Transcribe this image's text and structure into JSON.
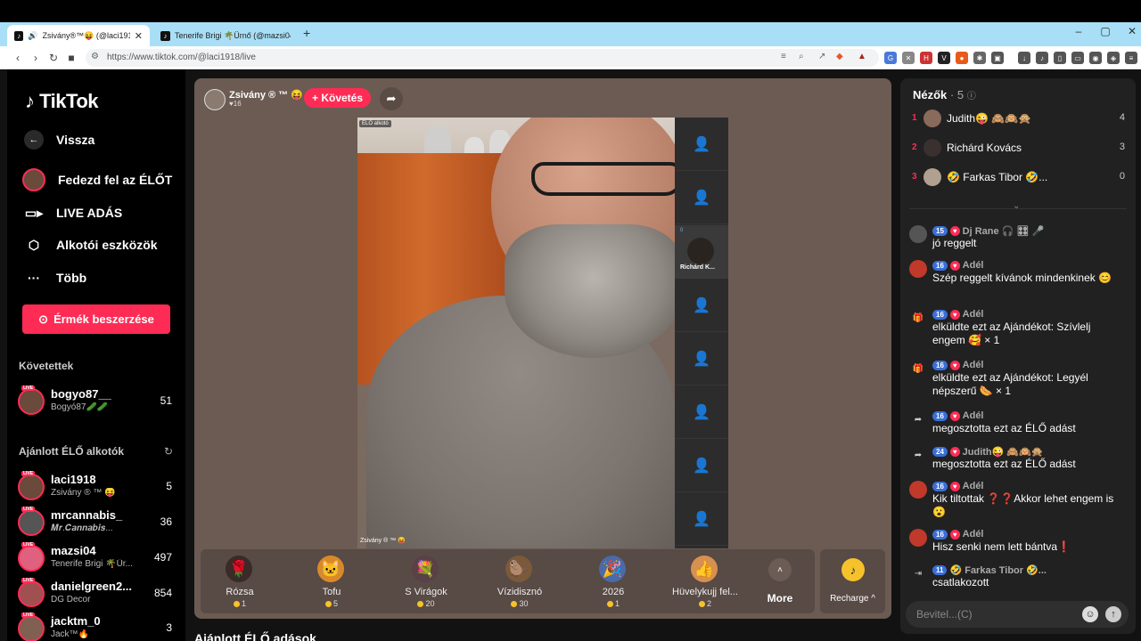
{
  "browser": {
    "tabs": [
      {
        "title": "Zsivány®™😝 (@laci1918) É..."
      },
      {
        "title": "Tenerife Brigi 🌴Ürnő (@mazsi04) É..."
      }
    ],
    "url": "https://www.tiktok.com/@laci1918/live"
  },
  "sidebar": {
    "logo": "TikTok",
    "back_label": "Vissza",
    "nav": [
      {
        "label": "Fedezd fel az ÉLŐT",
        "icon": "avatar-icon"
      },
      {
        "label": "LIVE ADÁS",
        "icon": "camera-icon"
      },
      {
        "label": "Alkotói eszközök",
        "icon": "creator-tools-icon"
      },
      {
        "label": "Több",
        "icon": "more-dots-icon"
      }
    ],
    "coins_button": "Érmék beszerzése",
    "following_header": "Követettek",
    "following": [
      {
        "name": "bogyo87__",
        "sub": "Bogyó87🥒🥒",
        "count": "51"
      }
    ],
    "recommended_header": "Ajánlott ÉLŐ alkotók",
    "recommended": [
      {
        "name": "laci1918",
        "sub": "Zsivány ® ™ 😝",
        "count": "5"
      },
      {
        "name": "mrcannabis_",
        "sub": "𝑴𝒓.𝑪𝒂𝒏𝒏𝒂𝒃𝒊𝒔...",
        "count": "36"
      },
      {
        "name": "mazsi04",
        "sub": "Tenerife Brigi 🌴Ür...",
        "count": "497"
      },
      {
        "name": "danielgreen2...",
        "sub": "DG Decor",
        "count": "854"
      },
      {
        "name": "jacktm_0",
        "sub": "Jack™🔥",
        "count": "3"
      }
    ],
    "live_badge": "LIVE"
  },
  "stream": {
    "host_name": "Zsivány ® ™ 😝",
    "host_likes": "♥16",
    "follow_label": "+ Követés",
    "creator_badge": "ÉLŐ alkotó",
    "video_caption": "Zsivány ® ™ 😝",
    "guest_name": "Richárd K...",
    "guest_count": "0"
  },
  "gifts": [
    {
      "name": "Rózsa",
      "price": "1",
      "icon": "🌹",
      "color": "#3a2a28"
    },
    {
      "name": "Tofu",
      "price": "5",
      "icon": "🐱",
      "color": "#d88a2a"
    },
    {
      "name": "S Virágok",
      "price": "20",
      "icon": "💐",
      "color": "#5a4048"
    },
    {
      "name": "Vízidisznó",
      "price": "30",
      "icon": "🦫",
      "color": "#7a5a3a"
    },
    {
      "name": "2026",
      "price": "1",
      "icon": "🎉",
      "color": "#4a6aa8"
    },
    {
      "name": "Hüvelykujj fel...",
      "price": "2",
      "icon": "👍",
      "color": "#d89050"
    }
  ],
  "more_label": "More",
  "recharge_label": "Recharge ^",
  "recommended_title": "Ajánlott ÉLŐ adások",
  "chat": {
    "viewers_title": "Nézők",
    "viewers_count": "· 5",
    "viewers": [
      {
        "rank": "1",
        "name": "Judith😜 🙈🙉🙊",
        "score": "4"
      },
      {
        "rank": "2",
        "name": "Richárd Kovács",
        "score": "3"
      },
      {
        "rank": "3",
        "name": "🤣 Farkas Tibor 🤣...",
        "score": "0"
      }
    ],
    "messages": [
      {
        "level": "15",
        "user": "Dj Rane 🎧 🎛 🎤",
        "text": "jó reggelt"
      },
      {
        "level": "16",
        "user": "Adél",
        "text": "Szép reggelt kívánok mindenkinek 😊"
      },
      {
        "level": "16",
        "user": "Adél",
        "text": "elküldte ezt az Ajándékot: Szívlelj engem 🥰 × 1"
      },
      {
        "level": "16",
        "user": "Adél",
        "text": "elküldte ezt az Ajándékot: Legyél népszerű 🌭 × 1"
      },
      {
        "level": "16",
        "user": "Adél",
        "text": "megosztotta ezt az ÉLŐ adást"
      },
      {
        "level": "24",
        "user": "Judith😜 🙈🙉🙊",
        "text": "megosztotta ezt az ÉLŐ adást"
      },
      {
        "level": "16",
        "user": "Adél",
        "text": "Kik tiltottak ❓❓Akkor lehet engem is 😮"
      },
      {
        "level": "16",
        "user": "Adél",
        "text": "Hisz senki nem lett bántva❗"
      },
      {
        "level": "11",
        "user": "🤣 Farkas Tibor 🤣...",
        "text": "csatlakozott"
      }
    ],
    "input_placeholder": "Bevitel...(C)"
  }
}
